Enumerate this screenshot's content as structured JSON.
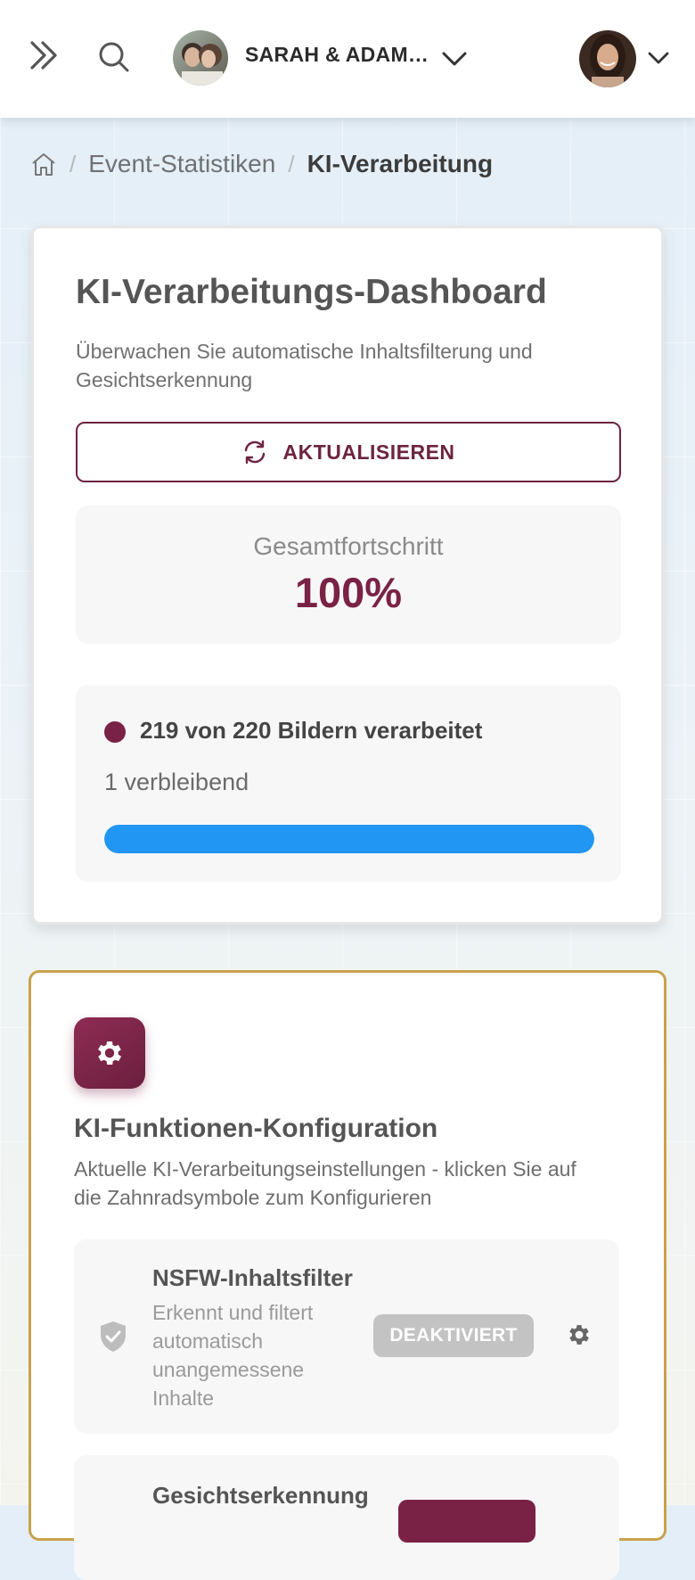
{
  "header": {
    "event_name": "SARAH & ADAM…"
  },
  "breadcrumb": {
    "items": [
      "Event-Statistiken",
      "KI-Verarbeitung"
    ],
    "separator": "/"
  },
  "dashboard": {
    "title": "KI-Verarbeitungs-Dashboard",
    "description": "Überwachen Sie automatische Inhaltsfilterung und Gesichtserkennung",
    "refresh_label": "AKTUALISIEREN",
    "overall_label": "Gesamtfortschritt",
    "overall_value": "100%",
    "status_text": "219 von 220 Bildern verarbeitet",
    "remaining_text": "1 verbleibend",
    "progress_fraction": 1.0
  },
  "config": {
    "title": "KI-Funktionen-Konfiguration",
    "description": "Aktuelle KI-Verarbeitungseinstellungen - klicken Sie auf die Zahnradsymbole zum Konfigurieren",
    "features": [
      {
        "title": "NSFW-Inhaltsfilter",
        "description": "Erkennt und filtert automatisch unangemessene Inhalte",
        "status": "DEAKTIVIERT"
      },
      {
        "title": "Gesichtserkennung"
      }
    ]
  },
  "colors": {
    "brand": "#7a2245",
    "progress": "#2196f3",
    "card_border_gold": "#c9a24c",
    "badge_disabled": "#c3c3c3"
  }
}
